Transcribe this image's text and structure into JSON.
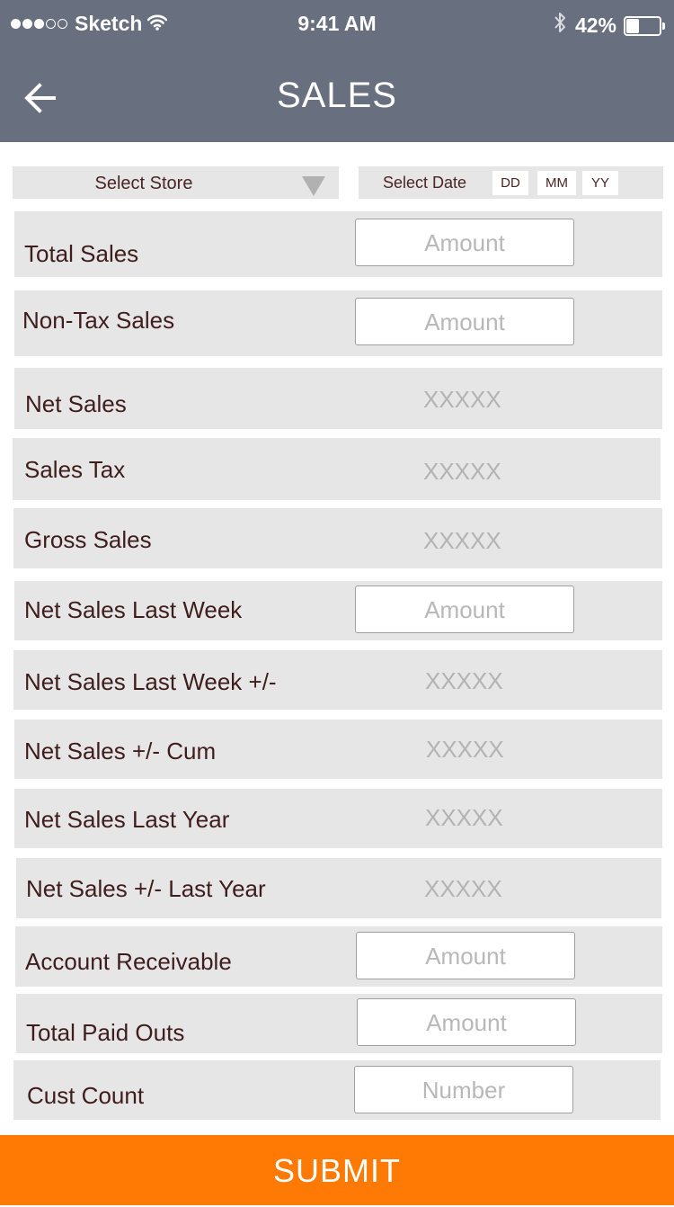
{
  "status_bar": {
    "carrier": "Sketch",
    "time": "9:41 AM",
    "battery_percent": "42%",
    "battery_level": 0.42,
    "signal_bars_filled": 3,
    "signal_bars_total": 5
  },
  "header": {
    "title": "SALES",
    "back_icon": "arrow-left-icon"
  },
  "filters": {
    "store_label": "Select Store",
    "date_label": "Select Date",
    "dd": "DD",
    "mm": "MM",
    "yy": "YY"
  },
  "rows": [
    {
      "label": "Total Sales",
      "type": "input",
      "value": "Amount"
    },
    {
      "label": "Non-Tax Sales",
      "type": "input",
      "value": "Amount"
    },
    {
      "label": "Net Sales",
      "type": "readonly",
      "value": "XXXXX"
    },
    {
      "label": "Sales Tax",
      "type": "readonly",
      "value": "XXXXX"
    },
    {
      "label": "Gross Sales",
      "type": "readonly",
      "value": "XXXXX"
    },
    {
      "label": "Net Sales Last Week",
      "type": "input",
      "value": "Amount"
    },
    {
      "label": "Net Sales Last Week +/-",
      "type": "readonly",
      "value": "XXXXX"
    },
    {
      "label": "Net Sales +/- Cum",
      "type": "readonly",
      "value": "XXXXX"
    },
    {
      "label": "Net Sales Last Year",
      "type": "readonly",
      "value": "XXXXX"
    },
    {
      "label": "Net Sales +/- Last Year",
      "type": "readonly",
      "value": "XXXXX"
    },
    {
      "label": "Account Receivable",
      "type": "input",
      "value": "Amount"
    },
    {
      "label": "Total Paid Outs",
      "type": "input",
      "value": "Amount"
    },
    {
      "label": "Cust Count",
      "type": "input",
      "value": "Number"
    }
  ],
  "submit_label": "SUBMIT",
  "colors": {
    "header": "#686f7f",
    "row_bg": "#e6e6e6",
    "label_text": "#3f1d1d",
    "placeholder_text": "#b8b8b8",
    "submit": "#ff7a05"
  }
}
